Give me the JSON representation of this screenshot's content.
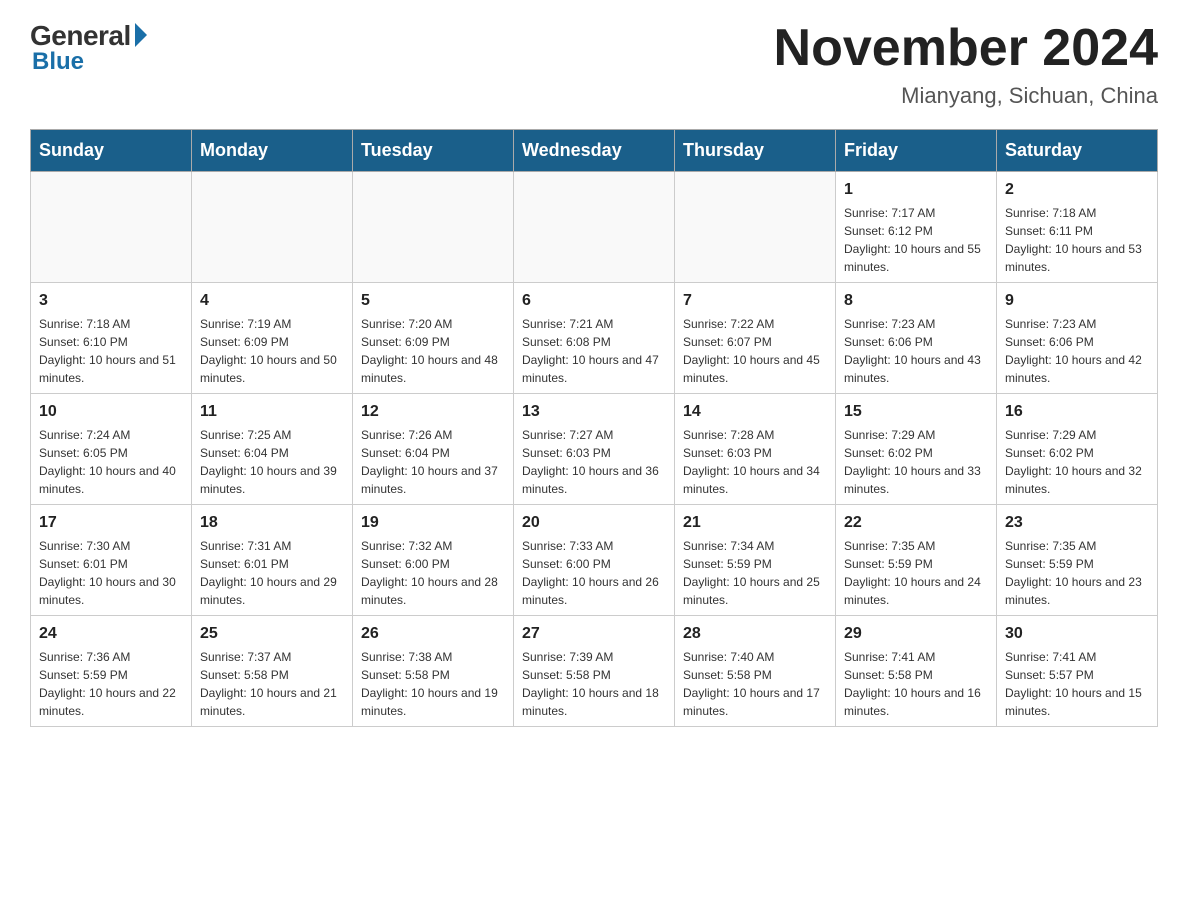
{
  "header": {
    "logo_general": "General",
    "logo_blue": "Blue",
    "month_year": "November 2024",
    "location": "Mianyang, Sichuan, China"
  },
  "days_of_week": [
    "Sunday",
    "Monday",
    "Tuesday",
    "Wednesday",
    "Thursday",
    "Friday",
    "Saturday"
  ],
  "weeks": [
    {
      "days": [
        {
          "num": "",
          "info": ""
        },
        {
          "num": "",
          "info": ""
        },
        {
          "num": "",
          "info": ""
        },
        {
          "num": "",
          "info": ""
        },
        {
          "num": "",
          "info": ""
        },
        {
          "num": "1",
          "info": "Sunrise: 7:17 AM\nSunset: 6:12 PM\nDaylight: 10 hours and 55 minutes."
        },
        {
          "num": "2",
          "info": "Sunrise: 7:18 AM\nSunset: 6:11 PM\nDaylight: 10 hours and 53 minutes."
        }
      ]
    },
    {
      "days": [
        {
          "num": "3",
          "info": "Sunrise: 7:18 AM\nSunset: 6:10 PM\nDaylight: 10 hours and 51 minutes."
        },
        {
          "num": "4",
          "info": "Sunrise: 7:19 AM\nSunset: 6:09 PM\nDaylight: 10 hours and 50 minutes."
        },
        {
          "num": "5",
          "info": "Sunrise: 7:20 AM\nSunset: 6:09 PM\nDaylight: 10 hours and 48 minutes."
        },
        {
          "num": "6",
          "info": "Sunrise: 7:21 AM\nSunset: 6:08 PM\nDaylight: 10 hours and 47 minutes."
        },
        {
          "num": "7",
          "info": "Sunrise: 7:22 AM\nSunset: 6:07 PM\nDaylight: 10 hours and 45 minutes."
        },
        {
          "num": "8",
          "info": "Sunrise: 7:23 AM\nSunset: 6:06 PM\nDaylight: 10 hours and 43 minutes."
        },
        {
          "num": "9",
          "info": "Sunrise: 7:23 AM\nSunset: 6:06 PM\nDaylight: 10 hours and 42 minutes."
        }
      ]
    },
    {
      "days": [
        {
          "num": "10",
          "info": "Sunrise: 7:24 AM\nSunset: 6:05 PM\nDaylight: 10 hours and 40 minutes."
        },
        {
          "num": "11",
          "info": "Sunrise: 7:25 AM\nSunset: 6:04 PM\nDaylight: 10 hours and 39 minutes."
        },
        {
          "num": "12",
          "info": "Sunrise: 7:26 AM\nSunset: 6:04 PM\nDaylight: 10 hours and 37 minutes."
        },
        {
          "num": "13",
          "info": "Sunrise: 7:27 AM\nSunset: 6:03 PM\nDaylight: 10 hours and 36 minutes."
        },
        {
          "num": "14",
          "info": "Sunrise: 7:28 AM\nSunset: 6:03 PM\nDaylight: 10 hours and 34 minutes."
        },
        {
          "num": "15",
          "info": "Sunrise: 7:29 AM\nSunset: 6:02 PM\nDaylight: 10 hours and 33 minutes."
        },
        {
          "num": "16",
          "info": "Sunrise: 7:29 AM\nSunset: 6:02 PM\nDaylight: 10 hours and 32 minutes."
        }
      ]
    },
    {
      "days": [
        {
          "num": "17",
          "info": "Sunrise: 7:30 AM\nSunset: 6:01 PM\nDaylight: 10 hours and 30 minutes."
        },
        {
          "num": "18",
          "info": "Sunrise: 7:31 AM\nSunset: 6:01 PM\nDaylight: 10 hours and 29 minutes."
        },
        {
          "num": "19",
          "info": "Sunrise: 7:32 AM\nSunset: 6:00 PM\nDaylight: 10 hours and 28 minutes."
        },
        {
          "num": "20",
          "info": "Sunrise: 7:33 AM\nSunset: 6:00 PM\nDaylight: 10 hours and 26 minutes."
        },
        {
          "num": "21",
          "info": "Sunrise: 7:34 AM\nSunset: 5:59 PM\nDaylight: 10 hours and 25 minutes."
        },
        {
          "num": "22",
          "info": "Sunrise: 7:35 AM\nSunset: 5:59 PM\nDaylight: 10 hours and 24 minutes."
        },
        {
          "num": "23",
          "info": "Sunrise: 7:35 AM\nSunset: 5:59 PM\nDaylight: 10 hours and 23 minutes."
        }
      ]
    },
    {
      "days": [
        {
          "num": "24",
          "info": "Sunrise: 7:36 AM\nSunset: 5:59 PM\nDaylight: 10 hours and 22 minutes."
        },
        {
          "num": "25",
          "info": "Sunrise: 7:37 AM\nSunset: 5:58 PM\nDaylight: 10 hours and 21 minutes."
        },
        {
          "num": "26",
          "info": "Sunrise: 7:38 AM\nSunset: 5:58 PM\nDaylight: 10 hours and 19 minutes."
        },
        {
          "num": "27",
          "info": "Sunrise: 7:39 AM\nSunset: 5:58 PM\nDaylight: 10 hours and 18 minutes."
        },
        {
          "num": "28",
          "info": "Sunrise: 7:40 AM\nSunset: 5:58 PM\nDaylight: 10 hours and 17 minutes."
        },
        {
          "num": "29",
          "info": "Sunrise: 7:41 AM\nSunset: 5:58 PM\nDaylight: 10 hours and 16 minutes."
        },
        {
          "num": "30",
          "info": "Sunrise: 7:41 AM\nSunset: 5:57 PM\nDaylight: 10 hours and 15 minutes."
        }
      ]
    }
  ]
}
